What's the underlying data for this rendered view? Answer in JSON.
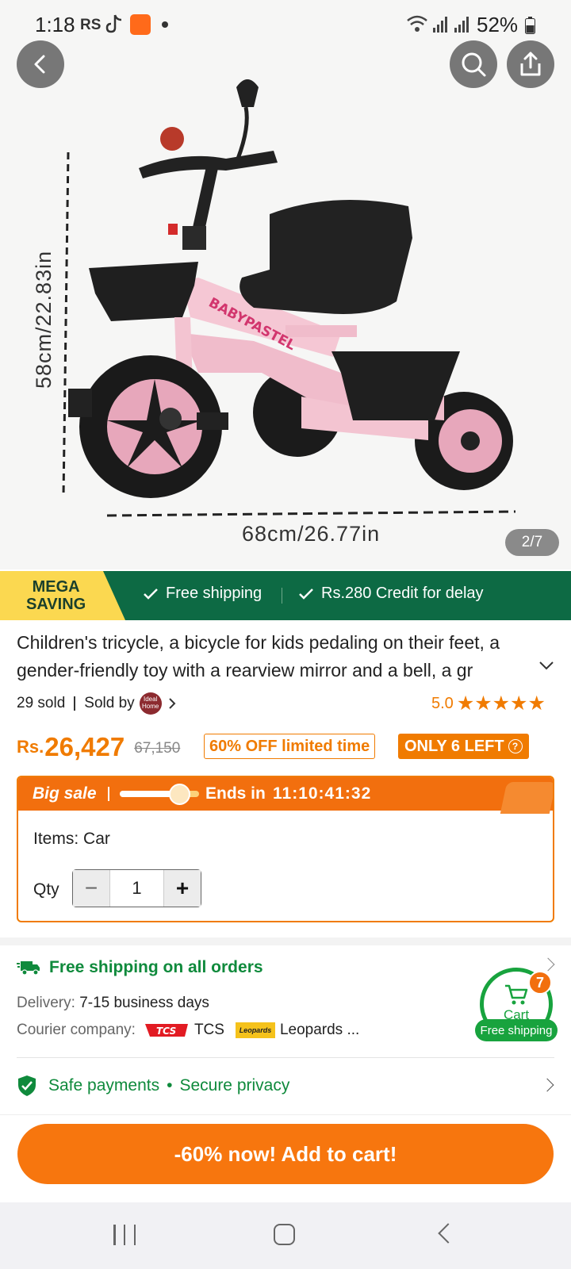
{
  "status_bar": {
    "time": "1:18",
    "carrier": "RS",
    "battery": "52%"
  },
  "gallery": {
    "height_label": "58cm/22.83in",
    "width_label": "68cm/26.77in",
    "brand_text": "BABYPASTEL",
    "counter": "2/7"
  },
  "promo": {
    "mega_line1": "MEGA",
    "mega_line2": "SAVING",
    "free_shipping": "Free shipping",
    "credit": "Rs.280 Credit for delay"
  },
  "product": {
    "title": "Children's tricycle, a bicycle for kids pedaling on their feet, a gender-friendly toy with a rearview mirror and a bell, a gr",
    "sold": "29 sold",
    "sold_by": "Sold by",
    "seller_logo_text": "Ideal Home",
    "rating": "5.0",
    "stars": "★★★★★",
    "currency": "Rs.",
    "price": "26,427",
    "old_price": "67,150",
    "discount_badge": "60% OFF limited time",
    "stock_badge": "ONLY 6 LEFT",
    "stock_help": "?"
  },
  "big_sale": {
    "label": "Big sale",
    "progress": 0.78,
    "ends_label": "Ends in",
    "countdown": "11:10:41:32",
    "items_key": "Items:",
    "items_value": "Car",
    "qty_label": "Qty",
    "qty_value": "1",
    "minus": "−",
    "plus": "+"
  },
  "shipping": {
    "headline": "Free shipping on all orders",
    "delivery_key": "Delivery:",
    "delivery_value": "7-15 business days",
    "courier_key": "Courier company:",
    "courier1": "TCS",
    "courier2": "Leopards ...",
    "tcs_logo_text": "TCS",
    "leopards_logo_text": "Leopards"
  },
  "cart": {
    "label": "Cart",
    "badge": "7",
    "free": "Free shipping"
  },
  "safe": {
    "text1": "Safe payments",
    "dot": "•",
    "text2": "Secure privacy"
  },
  "cta": {
    "label": "-60% now! Add to cart!"
  },
  "colors": {
    "accent": "#f07b00",
    "green": "#0f8a3c",
    "banner": "#0d6a44",
    "mega": "#fbd850"
  }
}
